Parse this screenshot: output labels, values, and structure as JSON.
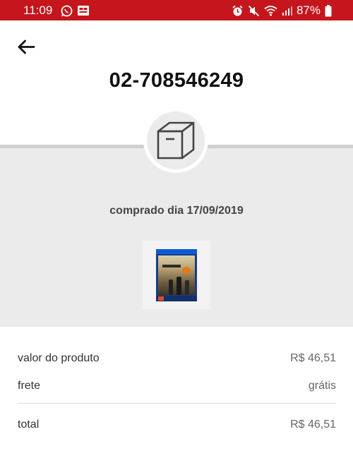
{
  "status_bar": {
    "time": "11:09",
    "battery": "87%",
    "background_color": "#c4161c",
    "left_icons": [
      "whatsapp-icon",
      "notification-icon"
    ],
    "right_icons": [
      "alarm-icon",
      "mute-icon",
      "wifi-icon",
      "signal-icon",
      "battery-icon"
    ]
  },
  "header": {
    "back_icon": "arrow-left-icon",
    "order_number": "02-708546249"
  },
  "order": {
    "box_icon": "package-box-icon",
    "purchase_date": "comprado dia 17/09/2019",
    "product_image": "game-cover-thumbnail"
  },
  "summary": {
    "product_label": "valor do produto",
    "product_value": "R$ 46,51",
    "shipping_label": "frete",
    "shipping_value": "grátis",
    "total_label": "total",
    "total_value": "R$ 46,51"
  }
}
